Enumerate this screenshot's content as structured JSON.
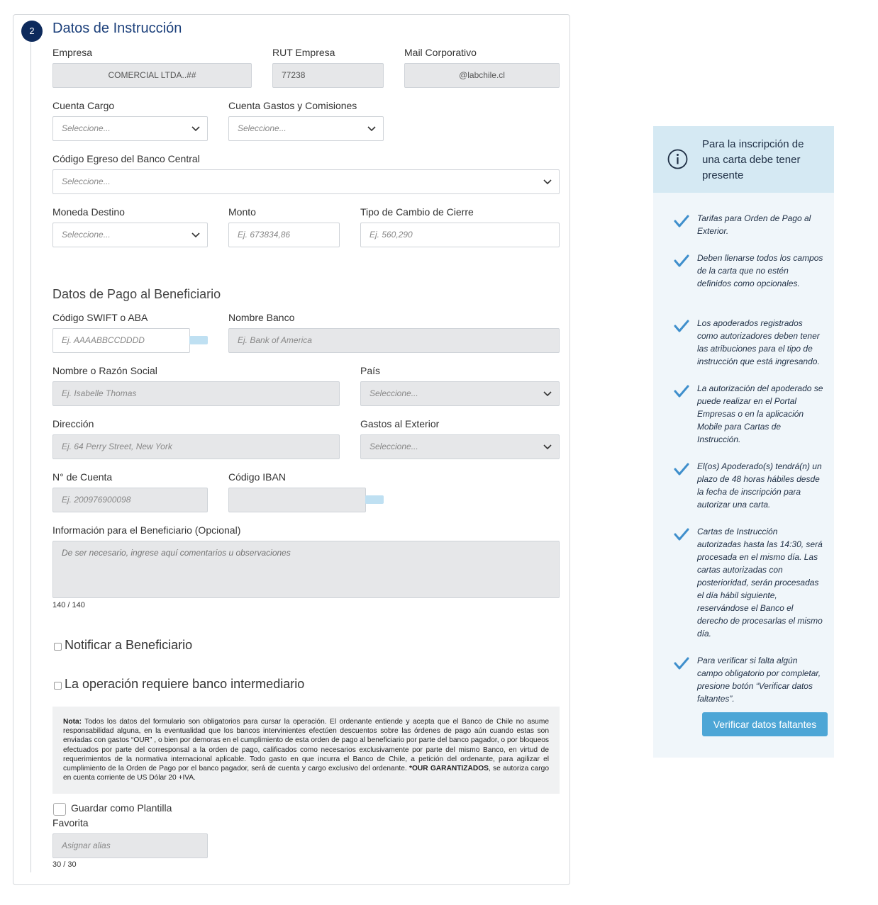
{
  "section": {
    "step": "2",
    "title": "Datos de Instrucción",
    "subsection_title": "Datos de Pago al Beneficiario"
  },
  "labels": {
    "empresa": "Empresa",
    "rut": "RUT Empresa",
    "mail": "Mail Corporativo",
    "cuenta_cargo": "Cuenta Cargo",
    "cuenta_gastos": "Cuenta Gastos y Comisiones",
    "codigo_egreso": "Código Egreso del Banco Central",
    "moneda": "Moneda Destino",
    "monto": "Monto",
    "tipo_cambio": "Tipo de Cambio de Cierre",
    "swift": "Código SWIFT o ABA",
    "nombre_banco": "Nombre Banco",
    "nombre_razon": "Nombre o Razón Social",
    "pais": "País",
    "direccion": "Dirección",
    "gastos_exterior": "Gastos al Exterior",
    "n_cuenta": "N° de Cuenta",
    "iban": "Código IBAN",
    "info_beneficiario": "Información para el Beneficiario (Opcional)"
  },
  "values": {
    "empresa": "COMERCIAL LTDA..##",
    "rut": "77238",
    "mail": "@labchile.cl"
  },
  "placeholders": {
    "select": "Seleccione...",
    "monto": "Ej. 673834,86",
    "tipo_cambio": "Ej. 560,290",
    "swift": "Ej. AAAABBCCDDDD",
    "nombre_banco": "Ej. Bank of America",
    "nombre_razon": "Ej. Isabelle Thomas",
    "direccion": "Ej. 64 Perry Street, New York",
    "n_cuenta": "Ej. 200976900098",
    "info_beneficiario": "De ser necesario, ingrese aquí comentarios u observaciones",
    "alias": "Asignar alias"
  },
  "counters": {
    "info": "140 / 140",
    "alias": "30 / 30"
  },
  "checkboxes": {
    "notificar": "Notificar a Beneficiario",
    "intermediario": "La operación requiere banco intermediario",
    "guardar": "Guardar como Plantilla",
    "favorita": "Favorita"
  },
  "nota": {
    "label": "Nota:",
    "text": " Todos los datos del formulario son obligatorios para cursar la operación. El ordenante entiende y acepta que el Banco de Chile no asume responsabilidad alguna, en la eventualidad que los bancos intervinientes efectúen descuentos sobre las órdenes de pago aún cuando estas son enviadas con gastos “OUR” , o bien por demoras en el cumplimiento de esta orden de pago al beneficiario por parte del banco pagador, o por bloqueos efectuados por parte del corresponsal a la orden de pago, calificados como necesarios exclusivamente por parte del mismo Banco, en virtud de requerimientos de la normativa internacional aplicable. Todo gasto en que incurra el Banco de Chile, a petición del ordenante, para agilizar el cumplimiento de la Orden de Pago por el banco pagador, será de cuenta y cargo exclusivo del ordenante. ",
    "bold": "*OUR GARANTIZADOS",
    "tail": ", se autoriza cargo en cuenta corriente de US Dólar 20 +IVA."
  },
  "info_box": {
    "title": "Para la inscripción de una carta debe tener presente",
    "tips": [
      "Tarifas para Orden de Pago al Exterior.",
      "Deben llenarse todos los campos de la carta que no estén definidos como opcionales.",
      "Los apoderados registrados como autorizadores deben tener las atribuciones para el tipo de instrucción que está ingresando.",
      "La autorización del apoderado se puede realizar en el Portal Empresas o en la aplicación Mobile para Cartas de Instrucción.",
      "El(os) Apoderado(s) tendrá(n) un plazo de 48 horas hábiles desde la fecha de inscripción para autorizar una carta.",
      "Cartas de Instrucción autorizadas hasta las 14:30, será procesada en el mismo día. Las cartas autorizadas con posterioridad, serán procesadas el día hábil siguiente, reservándose el Banco el derecho de procesarlas el mismo día.",
      "Para verificar si falta algún campo obligatorio por completar, presione botón “Verificar datos faltantes”."
    ],
    "button": "Verificar datos faltantes"
  },
  "colors": {
    "primary": "#0d2a5c",
    "accent": "#4da6d6",
    "info_head_bg": "#d5e9f3",
    "info_body_bg": "#f0f6fa"
  }
}
